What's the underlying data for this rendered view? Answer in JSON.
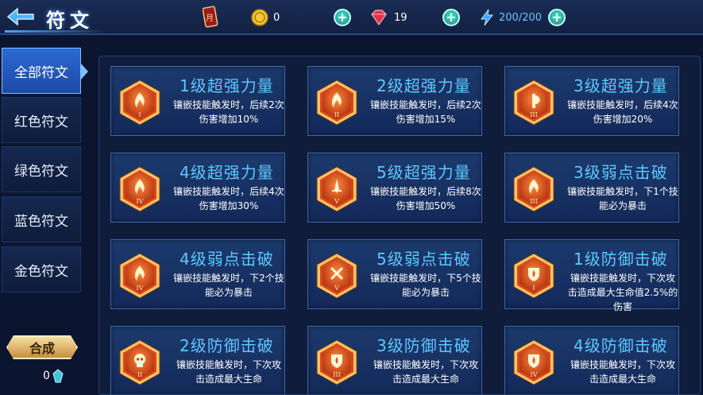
{
  "header": {
    "title": "符文",
    "gold": "0",
    "gems": "19",
    "energy_current": "200",
    "energy_max": "/200"
  },
  "sidebar": {
    "tabs": [
      {
        "label": "全部符文",
        "active": true
      },
      {
        "label": "红色符文",
        "active": false
      },
      {
        "label": "绿色符文",
        "active": false
      },
      {
        "label": "蓝色符文",
        "active": false
      },
      {
        "label": "金色符文",
        "active": false
      }
    ],
    "craft_label": "合成",
    "craft_count": "0"
  },
  "runes": [
    {
      "name": "1级超强力量",
      "desc": "镶嵌技能触发时，后续2次伤害增加10%",
      "tier": "I",
      "glyph": "flame"
    },
    {
      "name": "2级超强力量",
      "desc": "镶嵌技能触发时，后续2次伤害增加15%",
      "tier": "II",
      "glyph": "flame"
    },
    {
      "name": "3级超强力量",
      "desc": "镶嵌技能触发时，后续4次伤害增加20%",
      "tier": "III",
      "glyph": "axe"
    },
    {
      "name": "4级超强力量",
      "desc": "镶嵌技能触发时，后续4次伤害增加30%",
      "tier": "IV",
      "glyph": "flame"
    },
    {
      "name": "5级超强力量",
      "desc": "镶嵌技能触发时，后续8次伤害增加50%",
      "tier": "V",
      "glyph": "sword"
    },
    {
      "name": "3级弱点击破",
      "desc": "镶嵌技能触发时，下1个技能必为暴击",
      "tier": "III",
      "glyph": "flame"
    },
    {
      "name": "4级弱点击破",
      "desc": "镶嵌技能触发时，下2个技能必为暴击",
      "tier": "IV",
      "glyph": "flame"
    },
    {
      "name": "5级弱点击破",
      "desc": "镶嵌技能触发时，下5个技能必为暴击",
      "tier": "V",
      "glyph": "cross"
    },
    {
      "name": "1级防御击破",
      "desc": "镶嵌技能触发时，下次攻击造成最大生命值2.5%的伤害",
      "tier": "I",
      "glyph": "shield"
    },
    {
      "name": "2级防御击破",
      "desc": "镶嵌技能触发时，下次攻击造成最大生命",
      "tier": "II",
      "glyph": "skull"
    },
    {
      "name": "3级防御击破",
      "desc": "镶嵌技能触发时，下次攻击造成最大生命",
      "tier": "III",
      "glyph": "shield"
    },
    {
      "name": "4级防御击破",
      "desc": "镶嵌技能触发时，下次攻击造成最大生命",
      "tier": "IV",
      "glyph": "shield"
    }
  ],
  "colors": {
    "accent_blue": "#5fc7ff",
    "hex_orange": "#e0571c",
    "hex_gold": "#f6c66a",
    "card_bg": "#1c3a6c"
  }
}
